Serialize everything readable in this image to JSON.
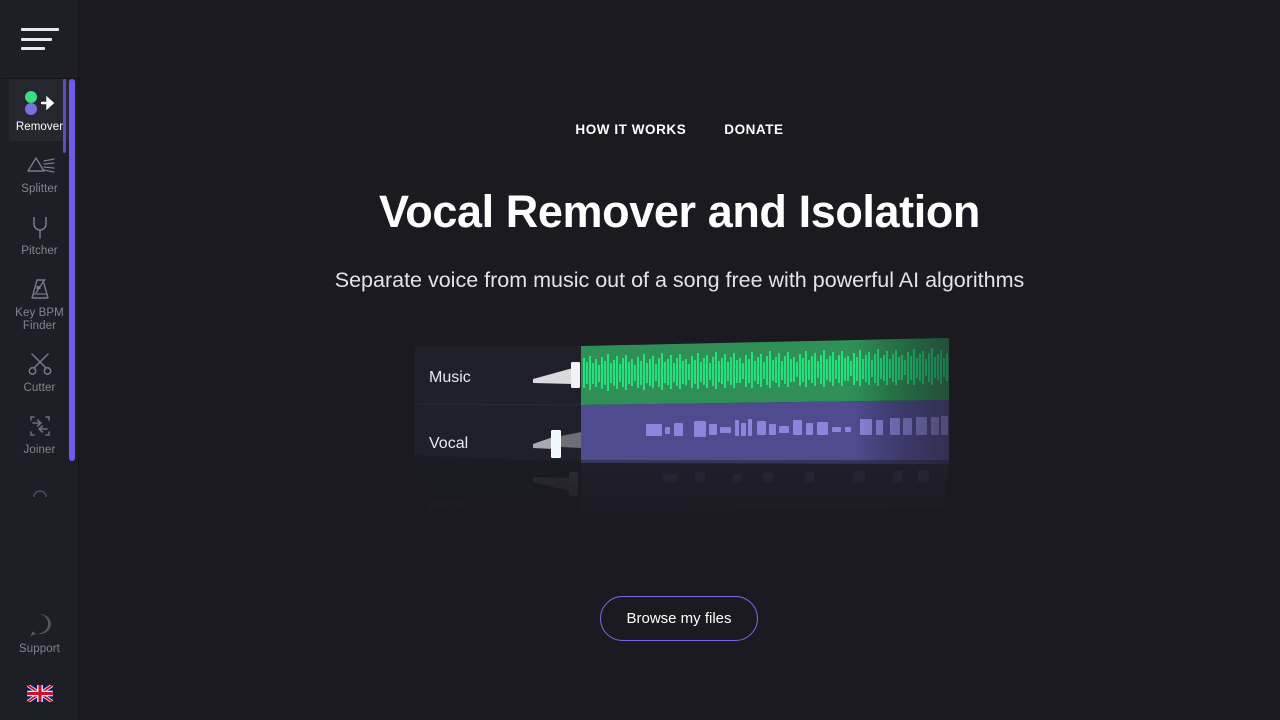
{
  "sidebar": {
    "menu_icon": "hamburger-menu-icon",
    "items": [
      {
        "label": "Remover",
        "icon": "remover-dots-arrow-icon",
        "active": true
      },
      {
        "label": "Splitter",
        "icon": "prism-splitter-icon",
        "active": false
      },
      {
        "label": "Pitcher",
        "icon": "tuning-fork-icon",
        "active": false
      },
      {
        "label": "Key BPM Finder",
        "icon": "metronome-icon",
        "active": false
      },
      {
        "label": "Cutter",
        "icon": "scissors-icon",
        "active": false
      },
      {
        "label": "Joiner",
        "icon": "merge-arrows-icon",
        "active": false
      }
    ],
    "support": {
      "label": "Support",
      "icon": "question-bubble-icon"
    },
    "language": {
      "icon": "uk-flag-icon"
    },
    "scrollbar_color": "#6c5ce7",
    "active_indicator_color": "#5b4ec4"
  },
  "header": {
    "nav": [
      {
        "label": "HOW IT WORKS"
      },
      {
        "label": "DONATE"
      }
    ]
  },
  "main": {
    "title": "Vocal Remover and Isolation",
    "subtitle": "Separate voice from music out of a song free with powerful AI algorithms",
    "browse_button": "Browse my files"
  },
  "hero": {
    "tracks": [
      {
        "name": "Music",
        "color": "#2f8f57",
        "wave_color": "#22e27e",
        "fader": "full"
      },
      {
        "name": "Vocal",
        "color": "#4f4b8f",
        "wave_color": "#7e78d6",
        "fader": "mid"
      }
    ],
    "reflection_label": "Vocal"
  },
  "colors": {
    "page_bg": "#1a1a20",
    "sidebar_bg": "#1e1e26",
    "accent": "#7a67e8",
    "music_green": "#22e27e",
    "vocal_purple": "#7e78d6"
  }
}
